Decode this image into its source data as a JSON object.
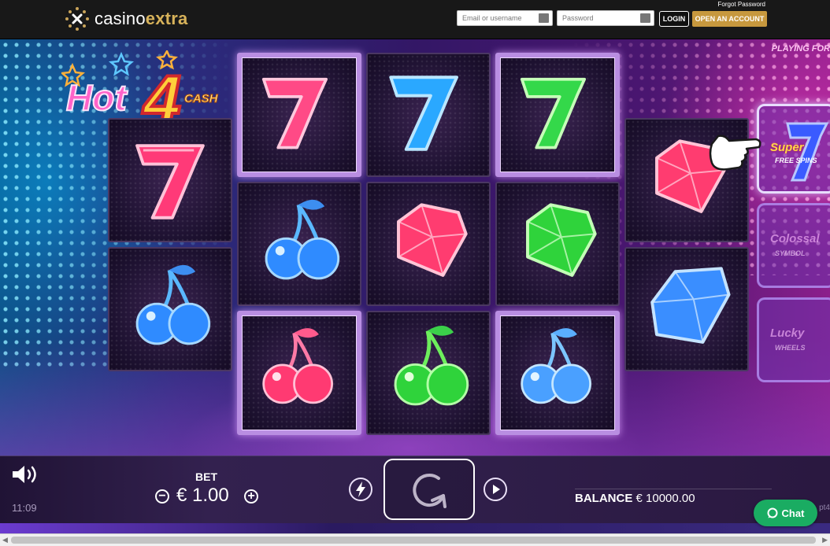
{
  "site": {
    "logo_text_a": "casino",
    "logo_text_b": "extra",
    "forgot_password": "Forgot Password",
    "email_placeholder": "Email or username",
    "password_placeholder": "Password",
    "login_label": "LOGIN",
    "open_account_label": "OPEN AN ACCOUNT"
  },
  "game": {
    "playing_for": "PLAYING FOR",
    "logo_hot": "Hot",
    "logo_4": "4",
    "logo_cash": "CASH",
    "reels": [
      [
        "seven-red",
        "cherry-blue"
      ],
      [
        "seven-red",
        "cherry-blue",
        "cherry-red"
      ],
      [
        "seven-blue",
        "gem-red",
        "cherry-green"
      ],
      [
        "seven-green",
        "gem-green",
        "cherry-blue"
      ],
      [
        "gem-red",
        "gem-blue"
      ]
    ],
    "features": [
      {
        "title": "Super",
        "subtitle": "FREE SPINS"
      },
      {
        "title": "Colossal",
        "subtitle": "SYMBOL"
      },
      {
        "title": "Lucky",
        "subtitle": "WHEELS"
      }
    ]
  },
  "controls": {
    "clock": "11:09",
    "bet_label": "BET",
    "bet_value": "€ 1.00",
    "balance_label": "BALANCE",
    "balance_value": "€ 10000.00",
    "trailing_text": "pt4",
    "chat_label": "Chat"
  },
  "colors": {
    "accent_gold": "#c7983e",
    "chat_green": "#1aac62",
    "header_bg": "#181818"
  }
}
